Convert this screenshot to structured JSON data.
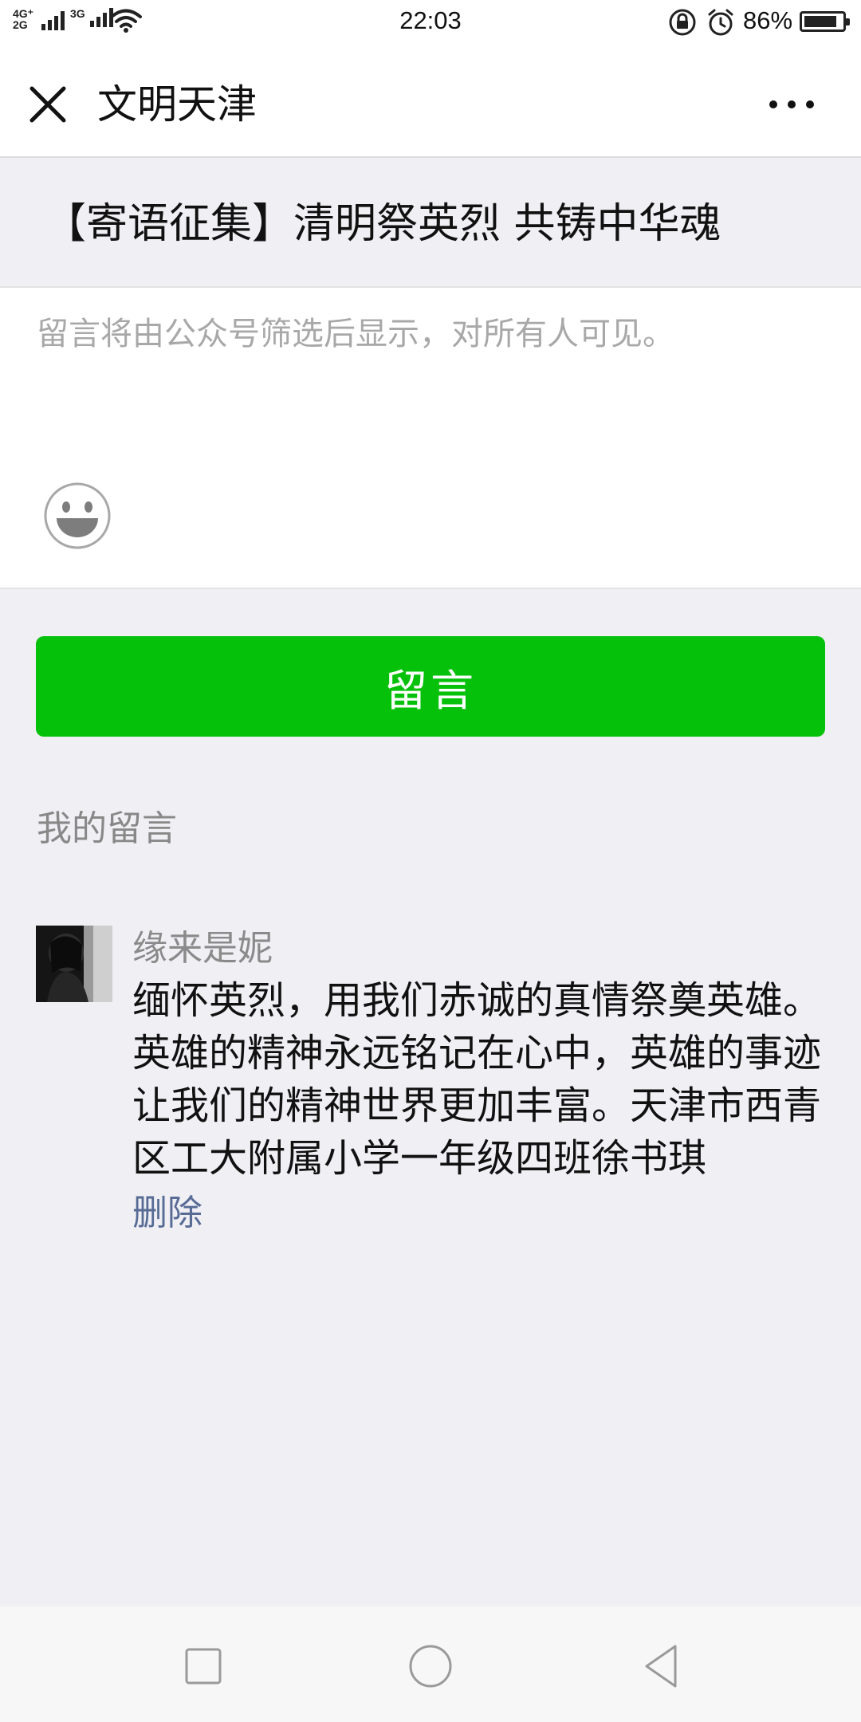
{
  "status_bar": {
    "network_top": "4G⁺",
    "network_bottom": "2G",
    "network_secondary": "3G",
    "time": "22:03",
    "battery_percent": "86%",
    "battery_level": 0.86,
    "icons": [
      "signal-icon",
      "wifi-icon",
      "rotation-lock-icon",
      "alarm-icon",
      "battery-icon"
    ]
  },
  "nav": {
    "close_icon": "close-icon",
    "title": "文明天津",
    "more_icon": "more-icon"
  },
  "article": {
    "title": "【寄语征集】清明祭英烈 共铸中华魂"
  },
  "composer": {
    "placeholder": "留言将由公众号筛选后显示，对所有人可见。",
    "value": "",
    "emoji_icon": "emoji-icon"
  },
  "submit": {
    "label": "留言",
    "color": "#05c10a"
  },
  "my_comments": {
    "section_title": "我的留言",
    "items": [
      {
        "author": "缘来是妮",
        "text": "缅怀英烈，用我们赤诚的真情祭奠英雄。\n英雄的精神永远铭记在心中，英雄的事迹让我们的精神世界更加丰富。天津市西青区工大附属小学一年级四班徐书琪",
        "delete_label": "删除"
      }
    ]
  },
  "system_nav": {
    "icons": [
      "recent-apps-icon",
      "home-icon",
      "back-icon"
    ]
  }
}
